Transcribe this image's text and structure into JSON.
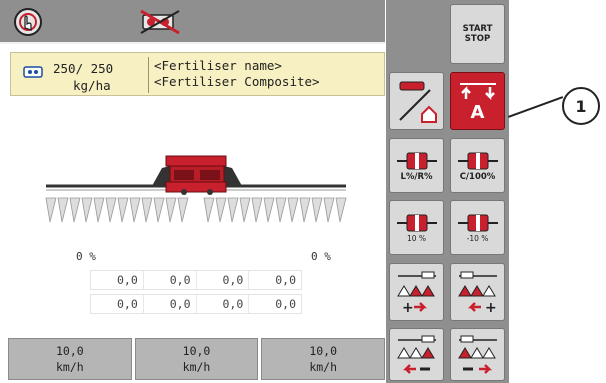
{
  "topbar": {
    "icons": [
      "hand-touch-icon",
      "disabled-section-control-icon"
    ]
  },
  "info": {
    "icon": "dosing-rate-icon",
    "rate_value": "250/ 250",
    "rate_unit": "kg/ha",
    "fertiliser_name": "<Fertiliser name>",
    "fertiliser_composite": "<Fertiliser Composite>"
  },
  "machine": {
    "left_percent": "0 %",
    "right_percent": "0 %",
    "values_row1": [
      "0,0",
      "0,0",
      "0,0",
      "0,0"
    ],
    "values_row2": [
      "0,0",
      "0,0",
      "0,0",
      "0,0"
    ]
  },
  "speeds": [
    {
      "value": "10,0",
      "unit": "km/h"
    },
    {
      "value": "10,0",
      "unit": "km/h"
    },
    {
      "value": "10,0",
      "unit": "km/h"
    }
  ],
  "buttons": {
    "start_stop": "START\nSTOP",
    "start": "START",
    "stop": "STOP",
    "auto_label": "A",
    "lr_pct": "L%/R%",
    "c_100": "C/100%",
    "plus_10": "10 %",
    "minus_10": "-10 %"
  },
  "callout": "1",
  "colors": {
    "accent_red": "#c8202c",
    "panel_grey": "#8f8f8f",
    "info_bg": "#f7f0c2"
  }
}
